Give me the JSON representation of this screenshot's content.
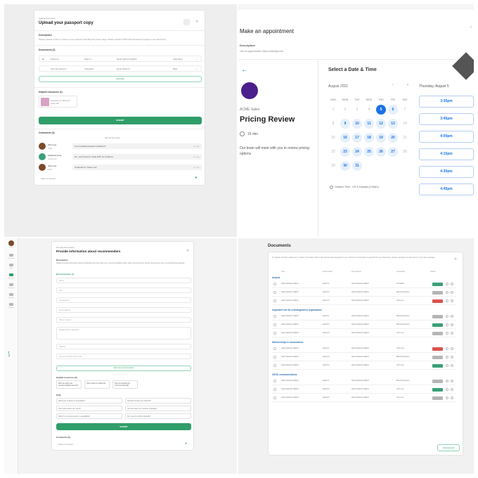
{
  "passport": {
    "kicker": "Upload document",
    "title": "Upload your passport copy",
    "description_label": "Description",
    "description": "Please upload a scan or photo of your passport including the photo page. Please upload a PDF with all passport pages in one document.",
    "documents_label": "Documents (2)",
    "doc_rows": [
      {
        "a": "Passport",
        "b": "Spain 1",
        "c": "Hand deliverd Hafard",
        "d": "Submitted"
      },
      {
        "a": "Second passport",
        "b": "Uploaded",
        "c": "Hand deliverd",
        "d": "Date"
      }
    ],
    "add_label": "Add files",
    "helpful_label": "Helpful resources (1)",
    "resource": "Example of passport scan.pdf",
    "submit": "SUBMIT",
    "comments_label": "Comments (3)",
    "comments_sub": "See all (3) notes",
    "comments": [
      {
        "name": "John Lee",
        "role": "Staff",
        "text": "Is an emailed passport sufficient?",
        "meta": "2h ago"
      },
      {
        "name": "Applicant User",
        "role": "Applicant",
        "text": "No, you'll need to notify PDF for evidence.",
        "meta": "1h ago"
      },
      {
        "name": "John Lee",
        "role": "Staff",
        "text": "Understood. Thank you!",
        "meta": "1h ago"
      }
    ],
    "add_comment": "Add a comment..."
  },
  "appointment": {
    "header": "Make an appointment",
    "desc_label": "Description",
    "desc": "Use an appointment: https://calendly.com",
    "company": "ACME Sales",
    "title": "Pricing Review",
    "duration": "15 min",
    "about": "Our team will meet with you to review pricing options",
    "select_title": "Select a Date & Time",
    "month": "August 2021",
    "weekdays": [
      "SUN",
      "MON",
      "TUE",
      "WED",
      "THU",
      "FRI",
      "SAT"
    ],
    "weeks": [
      [
        "1",
        "2",
        "3",
        "4",
        "5",
        "6",
        "7"
      ],
      [
        "8",
        "9",
        "10",
        "11",
        "12",
        "13",
        "14"
      ],
      [
        "15",
        "16",
        "17",
        "18",
        "19",
        "20",
        "21"
      ],
      [
        "22",
        "23",
        "24",
        "25",
        "26",
        "27",
        "28"
      ],
      [
        "29",
        "30",
        "31",
        "",
        "",
        "",
        ""
      ]
    ],
    "available": [
      "5",
      "6",
      "9",
      "10",
      "11",
      "12",
      "13",
      "16",
      "17",
      "18",
      "19",
      "20",
      "23",
      "24",
      "25",
      "26",
      "27",
      "30",
      "31"
    ],
    "selected": "5",
    "timezone": "Eastern Time - US & Canada (4:25am)",
    "selected_day": "Thursday, August 5",
    "slots": [
      "3:30pm",
      "3:45pm",
      "4:00pm",
      "4:15pm",
      "4:30pm",
      "4:45pm"
    ],
    "brand_color": "#1a73e8"
  },
  "recommenders": {
    "kicker": "Provide information",
    "title": "Provide information about recommenders",
    "desc_label": "Description",
    "desc": "Please provide information about individuals who can write you a recommendation letter. Each recommender should have known you in a professional capacity.",
    "section": "Recommender (1)",
    "fields": [
      "Name",
      "Title",
      "Organization",
      "Email address",
      "Phone number",
      "Relationship to applicant",
      "Address",
      "Recommendation letter date"
    ],
    "add_label": "Add more recommenders",
    "helpful_label": "Helpful resources (3)",
    "chips": [
      "Who can write your recommendation letter.pdf",
      "How to ask for a letter.pdf",
      "Tips on choosing the recommenders.pdf"
    ],
    "faq_label": "FAQ",
    "faqs": [
      "What type of letters is acceptable?",
      "Should the letter be notarized?",
      "How many letters do I need?",
      "Can the letter be in another language?",
      "What if my recommender is unavailable?",
      "Do I need to submit originals?"
    ],
    "submit": "SUBMIT",
    "comments_label": "Comments (0)",
    "add_comment": "Add a comment...",
    "nav": [
      "Home",
      "Dashboard",
      "Tasks",
      "Documents",
      "Messages",
      "Calendar",
      "Settings"
    ]
  },
  "documents": {
    "title": "Documents",
    "intro": "To upload new files, please go to \"Tasks\" and select a file in the relevant task assigned to you. If there is no task that is a good fit for your document, please message the document to your case manager.",
    "columns": [
      "Title",
      "Deliverable",
      "Description",
      "Uploaded",
      "Status"
    ],
    "groups": [
      {
        "name": "Awards",
        "rows": [
          {
            "t": "Hand deliverd Hafard",
            "d": "Award 1",
            "s": "Hand deliverd Hafard",
            "u": "Ali Dubbs",
            "st": "green"
          },
          {
            "t": "Hand deliverd Hafard",
            "d": "Award 2",
            "s": "Hand deliverd Hafard",
            "u": "Beverly Reseen",
            "st": "gray"
          },
          {
            "t": "Hand deliverd Hafard",
            "d": "Award 3",
            "s": "Hand deliverd Hafard",
            "u": "John Lee",
            "st": "red"
          }
        ]
      },
      {
        "name": "Important role for a distinguished organization",
        "rows": [
          {
            "t": "Hand deliverd Hafard",
            "d": "Award 1",
            "s": "Hand deliverd Hafard",
            "u": "Beverly Reseen",
            "st": "gray"
          },
          {
            "t": "Hand deliverd Hafard",
            "d": "Award 2",
            "s": "Hand deliverd Hafard",
            "u": "Beverly Reseen",
            "st": "green"
          },
          {
            "t": "Hand deliverd Hafard",
            "d": "Award 3",
            "s": "Hand deliverd Hafard",
            "u": "John Lee",
            "st": "gray"
          }
        ]
      },
      {
        "name": "Memberships in associations",
        "rows": [
          {
            "t": "Hand deliverd Hafard",
            "d": "Award 1",
            "s": "Hand deliverd Hafard",
            "u": "John Lee",
            "st": "red"
          },
          {
            "t": "Hand deliverd Hafard",
            "d": "Award 2",
            "s": "Hand deliverd Hafard",
            "u": "Beverly Reseen",
            "st": "gray"
          },
          {
            "t": "Hand deliverd Hafard",
            "d": "Award 3",
            "s": "Hand deliverd Hafard",
            "u": "John Lee",
            "st": "green"
          }
        ]
      },
      {
        "name": "OECD communications",
        "rows": [
          {
            "t": "Hand deliverd Hafard",
            "d": "Award 1",
            "s": "Hand deliverd Hafard",
            "u": "Beverly Reseen",
            "st": "gray"
          },
          {
            "t": "Hand deliverd Hafard",
            "d": "Award 2",
            "s": "Hand deliverd Hafard",
            "u": "John Lee",
            "st": "green"
          },
          {
            "t": "Hand deliverd Hafard",
            "d": "Award 3",
            "s": "Hand deliverd Hafard",
            "u": "John Lee",
            "st": "gray"
          }
        ]
      }
    ],
    "download": "Download all"
  }
}
